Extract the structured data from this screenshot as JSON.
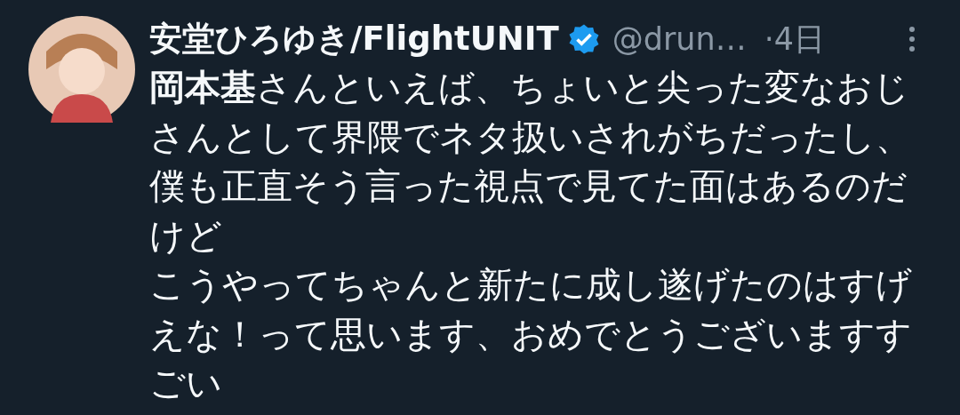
{
  "tweet": {
    "author": {
      "name": "安堂ひろゆき/FlightUNIT",
      "verified": true,
      "handle": "@drun…",
      "time": "·4日"
    },
    "paragraphs": [
      "**岡本基**さんといえば、ちょいと尖った変なおじさんとして界隈でネタ扱いされがちだったし、僕も正直そう言った視点で見てた面はあるのだけど",
      "こうやってちゃんと新たに成し遂げたのはすげえな！って思います、おめでとうございますすごい"
    ]
  }
}
